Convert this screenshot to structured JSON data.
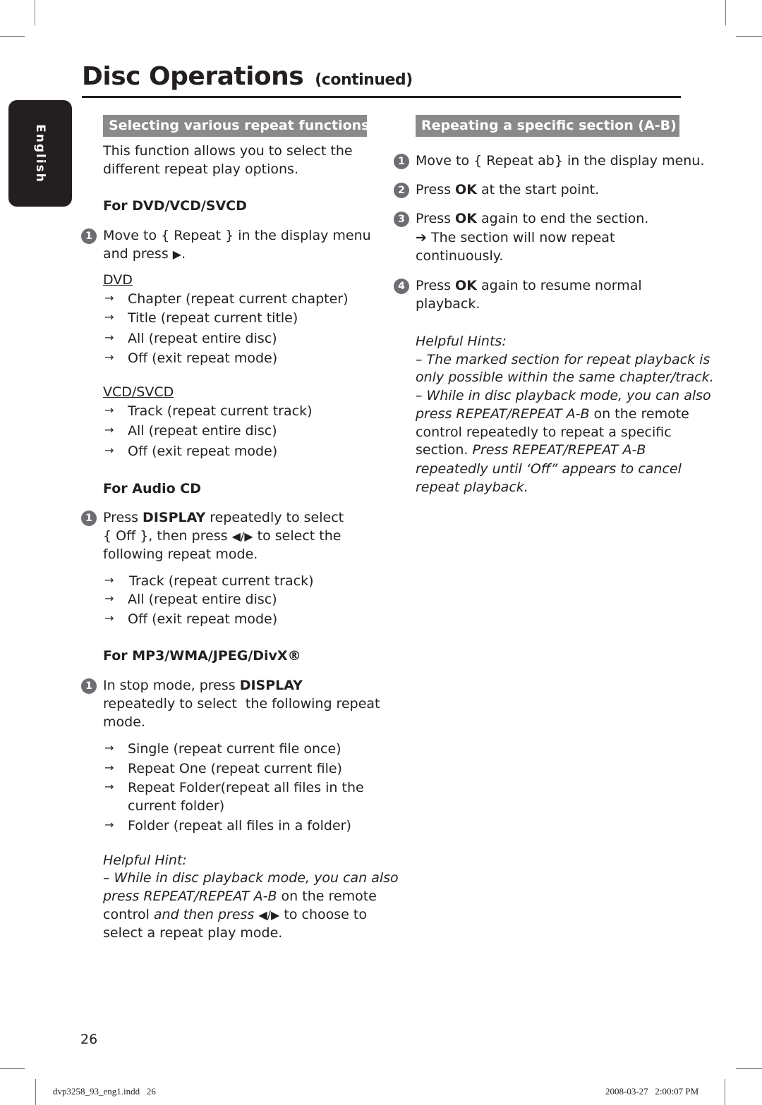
{
  "page": {
    "title": "Disc Operations",
    "title_suffix": "(continued)",
    "language_tab": "English",
    "page_number": "26",
    "footer_file": "dvp3258_93_eng1.indd   26",
    "footer_timestamp": "2008-03-27   2:00:07 PM"
  },
  "left": {
    "section_title": "Selecting various repeat functions",
    "intro": [
      "This function allows you to select the",
      "different repeat play options."
    ],
    "dvd_vcd": {
      "heading": "For DVD/VCD/SVCD",
      "step_num": "1",
      "step_lines": [
        "Move to { Repeat } in the display menu",
        "and press"
      ],
      "play_icon": "▶",
      "period": ".",
      "dvd_label": "DVD",
      "dvd_items": [
        "Chapter (repeat current chapter)",
        "Title (repeat current title)",
        "All (repeat entire disc)",
        "Off (exit repeat mode)"
      ],
      "vcd_label": "VCD/SVCD",
      "vcd_items": [
        "Track (repeat current track)",
        "All (repeat entire disc)",
        "Off (exit repeat mode)"
      ]
    },
    "audio_cd": {
      "heading": "For Audio CD",
      "step_num": "1",
      "line1_pre": "Press ",
      "line1_bold": "DISPLAY",
      "line1_post": " repeatedly to select",
      "line2_pre": "{ Off }, then press ",
      "line2_icons": "◀/▶",
      "line2_post": " to select the",
      "line3": "following repeat mode.",
      "items": [
        "Track (repeat current track)",
        "All (repeat entire disc)",
        "Off (exit repeat mode)"
      ]
    },
    "mp3": {
      "heading": "For MP3/WMA/JPEG/DivX®",
      "step_num": "1",
      "line1_pre": "In stop mode, press ",
      "line1_bold": "DISPLAY",
      "line2": "repeatedly to select  the following repeat",
      "line3": "mode.",
      "items": [
        "Single (repeat current file once)",
        "Repeat One (repeat current file)",
        "Repeat Folder(repeat all files in the",
        "Folder (repeat all files in a folder)"
      ],
      "item3_cont": "current folder)"
    },
    "hint": {
      "title": "Helpful Hint:",
      "line1": "–  While in disc playback mode, you can also",
      "line2_it": "press REPEAT/REPEAT A-B",
      "line2_post": " on the remote",
      "line3_pre": "control ",
      "line3_it": "and then press ",
      "line3_icons": "◀/▶",
      "line3_post": " to choose to",
      "line4": "select a repeat play mode."
    }
  },
  "right": {
    "section_title": "Repeating a specific section (A-B)",
    "steps": [
      {
        "num": "1",
        "pre": "Move to { Repeat ab} in the display menu.",
        "bold": "",
        "post": ""
      },
      {
        "num": "2",
        "pre": "Press ",
        "bold": "OK",
        "post": " at the start point."
      },
      {
        "num": "3",
        "pre": "Press ",
        "bold": "OK",
        "post": " again to end the section."
      },
      {
        "num": "4",
        "pre": "Press ",
        "bold": "OK",
        "post": " again to resume normal"
      }
    ],
    "step3_result": "➔ The section will now repeat",
    "step3_result_cont": "continuously.",
    "step4_cont": "playback.",
    "hints": {
      "title": "Helpful Hints:",
      "line1": "–  The marked section for repeat playback is",
      "line2": "only possible within the same chapter/track.",
      "line3": "–  While in disc playback mode, you can also",
      "line4_it": "press REPEAT/REPEAT A-B",
      "line4_post": " on the remote",
      "line5": "control repeatedly to repeat a specific",
      "line6_pre": "section. ",
      "line6_it": "Press REPEAT/REPEAT A-B",
      "line7": "repeatedly until ‘Off” appears to cancel",
      "line8": "repeat playback."
    }
  },
  "icons": {
    "arrow": "→"
  }
}
